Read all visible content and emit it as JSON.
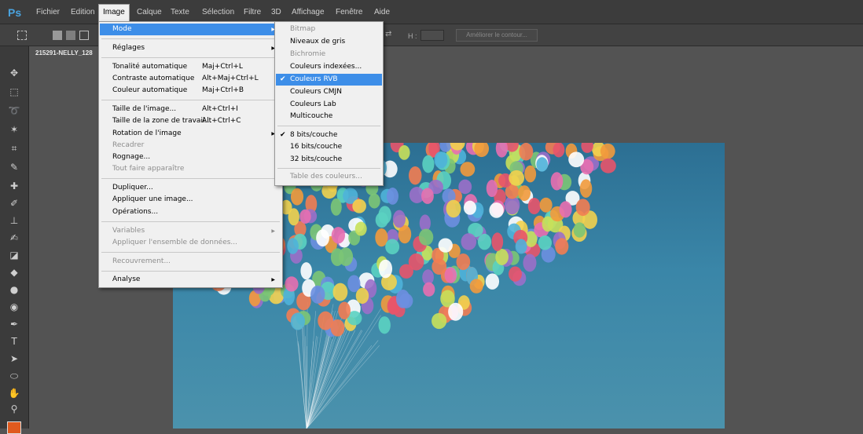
{
  "app": {
    "logo": "Ps"
  },
  "menubar": {
    "items": [
      "Fichier",
      "Edition",
      "Image",
      "Calque",
      "Texte",
      "Sélection",
      "Filtre",
      "3D",
      "Affichage",
      "Fenêtre",
      "Aide"
    ],
    "active": "Image"
  },
  "options_bar": {
    "h_label": "H :",
    "refine_label": "Améliorer le contour..."
  },
  "document": {
    "tab_title": "215291-NELLY_128"
  },
  "colors": {
    "foreground": "#e05a1e",
    "menu_highlight": "#3d8ee8"
  },
  "image_menu": {
    "mode": "Mode",
    "reglages": "Réglages",
    "tonalite": {
      "label": "Tonalité automatique",
      "shortcut": "Maj+Ctrl+L"
    },
    "contraste": {
      "label": "Contraste automatique",
      "shortcut": "Alt+Maj+Ctrl+L"
    },
    "couleur": {
      "label": "Couleur automatique",
      "shortcut": "Maj+Ctrl+B"
    },
    "taille_image": {
      "label": "Taille de l'image...",
      "shortcut": "Alt+Ctrl+I"
    },
    "taille_zone": {
      "label": "Taille de la zone de travail...",
      "shortcut": "Alt+Ctrl+C"
    },
    "rotation": "Rotation de l'image",
    "recadrer": "Recadrer",
    "rognage": "Rognage...",
    "tout_faire": "Tout faire apparaître",
    "dupliquer": "Dupliquer...",
    "appliquer_image": "Appliquer une image...",
    "operations": "Opérations...",
    "variables": "Variables",
    "appliquer_ensemble": "Appliquer l'ensemble de données...",
    "recouvrement": "Recouvrement...",
    "analyse": "Analyse"
  },
  "mode_submenu": {
    "bitmap": "Bitmap",
    "niveaux_gris": "Niveaux de gris",
    "bichromie": "Bichromie",
    "couleurs_indexees": "Couleurs indexées...",
    "couleurs_rvb": "Couleurs RVB",
    "couleurs_cmjn": "Couleurs CMJN",
    "couleurs_lab": "Couleurs Lab",
    "multicouche": "Multicouche",
    "bits8": "8 bits/couche",
    "bits16": "16 bits/couche",
    "bits32": "32 bits/couche",
    "table_couleurs": "Table des couleurs..."
  }
}
